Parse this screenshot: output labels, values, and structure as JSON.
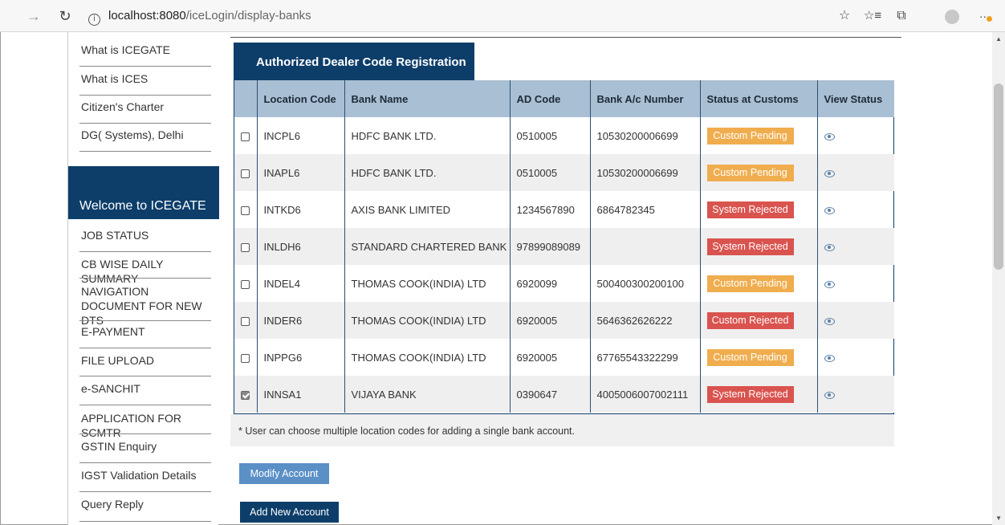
{
  "browser": {
    "url_host": "localhost:8080",
    "url_path": "/iceLogin/display-banks"
  },
  "sidebar": {
    "top_links": [
      "What is ICEGATE",
      "What is ICES",
      "Citizen's Charter",
      "DG( Systems), Delhi"
    ],
    "welcome": "Welcome to ICEGATE",
    "menu": [
      "JOB STATUS",
      "CB WISE DAILY SUMMARY",
      "NAVIGATION DOCUMENT FOR NEW DTS",
      "E-PAYMENT",
      "FILE UPLOAD",
      "e-SANCHIT",
      "APPLICATION FOR SCMTR",
      "GSTIN Enquiry",
      "IGST Validation Details",
      "Query Reply"
    ]
  },
  "main": {
    "tab_label": "Authorized Dealer Code Registration",
    "columns": [
      "Location Code",
      "Bank Name",
      "AD Code",
      "Bank A/c Number",
      "Status at Customs",
      "View Status"
    ],
    "rows": [
      {
        "checked": false,
        "location": "INCPL6",
        "bank": "HDFC BANK LTD.",
        "ad_code": "0510005",
        "account": "10530200006699",
        "status": "Custom Pending",
        "status_kind": "pending"
      },
      {
        "checked": false,
        "location": "INAPL6",
        "bank": "HDFC BANK LTD.",
        "ad_code": "0510005",
        "account": "10530200006699",
        "status": "Custom Pending",
        "status_kind": "pending"
      },
      {
        "checked": false,
        "location": "INTKD6",
        "bank": "AXIS BANK LIMITED",
        "ad_code": "1234567890",
        "account": "6864782345",
        "status": "System Rejected",
        "status_kind": "rejected"
      },
      {
        "checked": false,
        "location": "INLDH6",
        "bank": "STANDARD CHARTERED BANK",
        "ad_code": "97899089089",
        "account": "",
        "status": "System Rejected",
        "status_kind": "rejected"
      },
      {
        "checked": false,
        "location": "INDEL4",
        "bank": "THOMAS COOK(INDIA) LTD",
        "ad_code": "6920099",
        "account": "500400300200100",
        "status": "Custom Pending",
        "status_kind": "pending"
      },
      {
        "checked": false,
        "location": "INDER6",
        "bank": "THOMAS COOK(INDIA) LTD",
        "ad_code": "6920005",
        "account": "5646362626222",
        "status": "Custom Rejected",
        "status_kind": "rejected"
      },
      {
        "checked": false,
        "location": "INPPG6",
        "bank": "THOMAS COOK(INDIA) LTD",
        "ad_code": "6920005",
        "account": "67765543322299",
        "status": "Custom Pending",
        "status_kind": "pending"
      },
      {
        "checked": true,
        "location": "INNSA1",
        "bank": "VIJAYA BANK",
        "ad_code": "0390647",
        "account": "4005006007002111",
        "status": "System Rejected",
        "status_kind": "rejected"
      }
    ],
    "note": "* User can choose multiple location codes for adding a single bank account.",
    "modify_button": "Modify Account",
    "add_button": "Add New Account"
  },
  "colors": {
    "navy": "#0d3e6a",
    "header_blue": "#a9bfd3",
    "pending": "#f0ad4e",
    "rejected": "#d9534f",
    "modify_button": "#5b90c7"
  },
  "icons": {
    "back": "arrow-right-icon",
    "refresh": "refresh-icon",
    "info": "info-icon",
    "favorite": "star-icon",
    "favorites_bar": "favorites-icon",
    "collections": "collections-icon",
    "profile": "avatar-icon",
    "more": "more-icon",
    "view": "eye-icon"
  }
}
